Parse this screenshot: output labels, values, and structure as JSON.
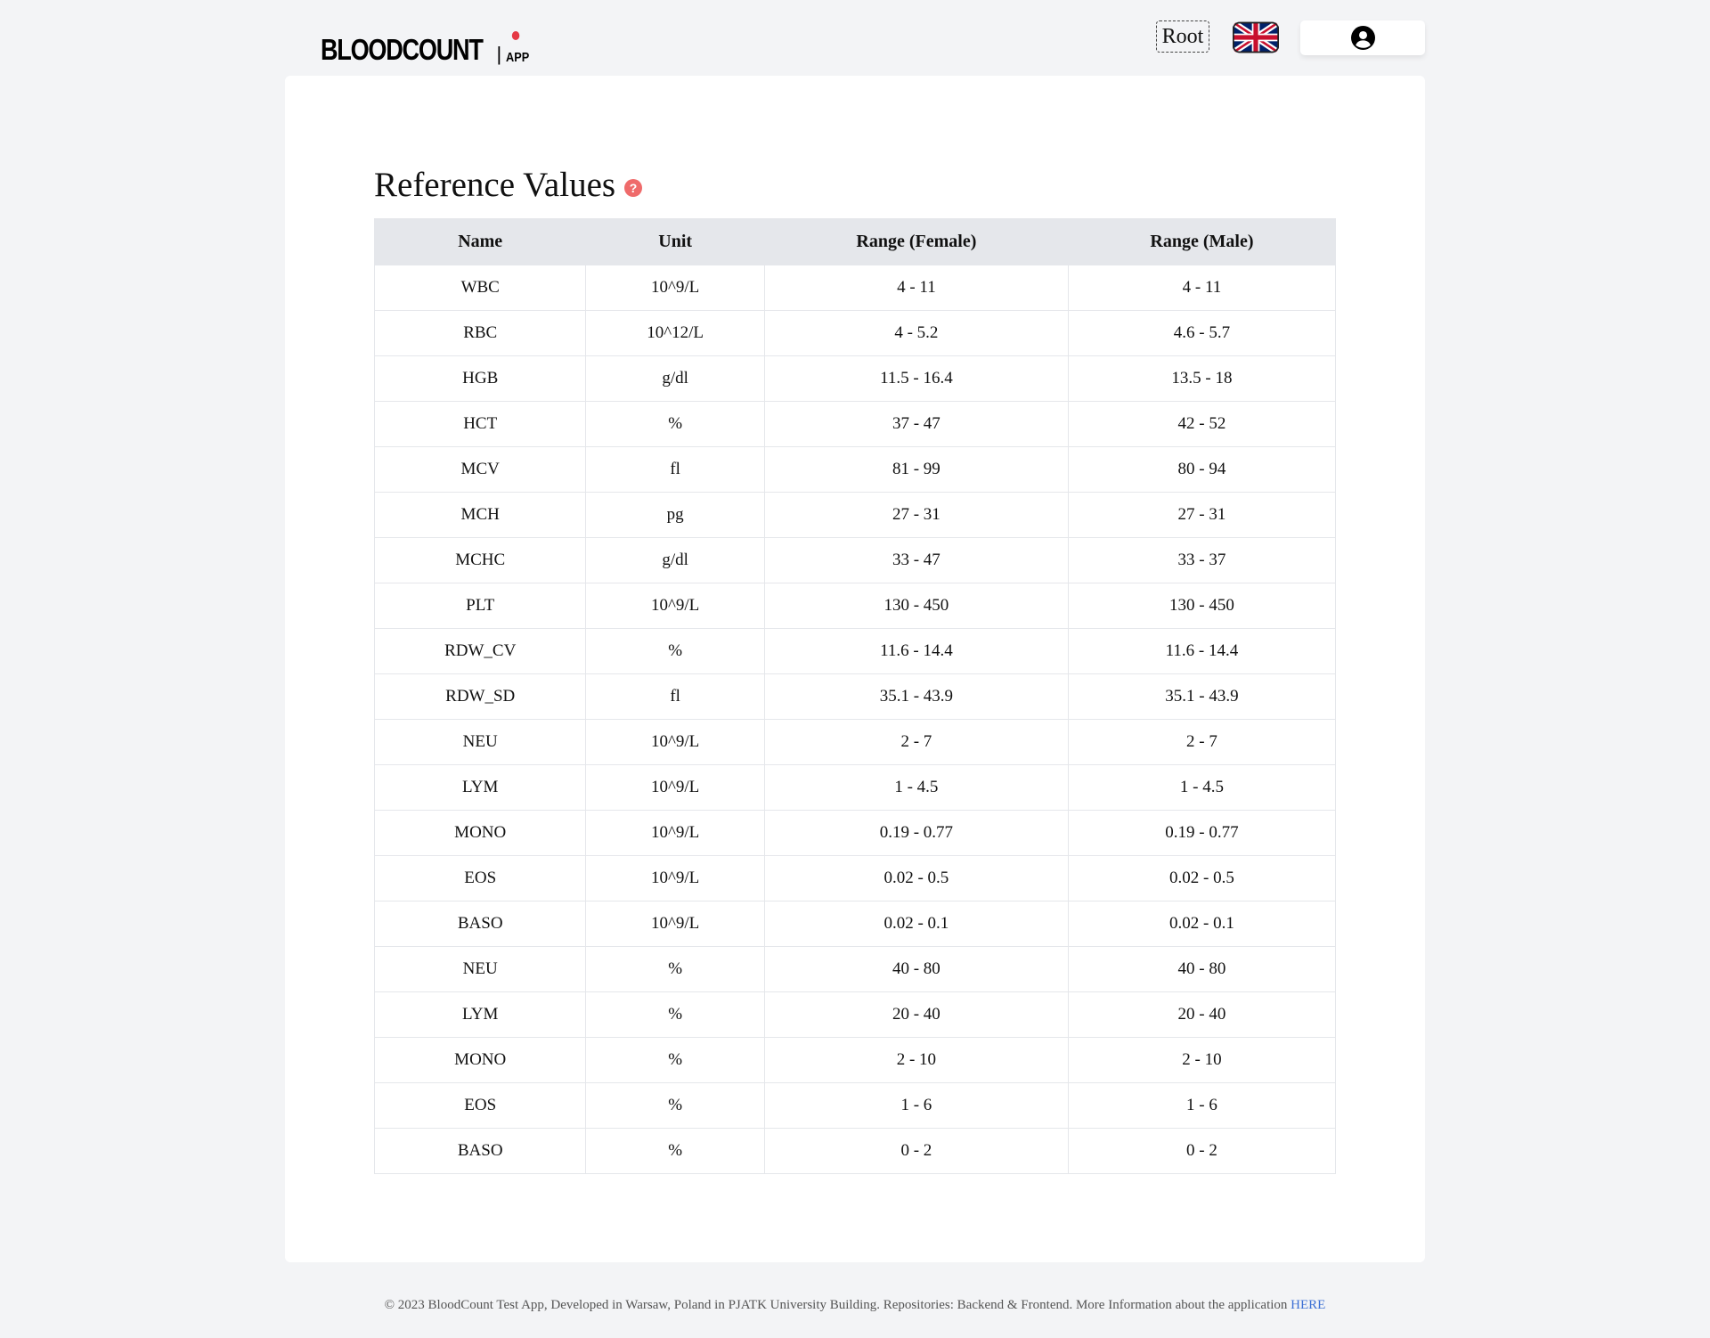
{
  "header": {
    "logo_main": "BLOODCOUNT",
    "logo_separator": "|",
    "logo_sub": "APP",
    "role_label": "Root",
    "language_icon": "uk-flag-icon",
    "account_icon": "user-circle-icon"
  },
  "main": {
    "title": "Reference Values",
    "help_icon": "question-circle-icon",
    "table": {
      "headers": [
        "Name",
        "Unit",
        "Range (Female)",
        "Range (Male)"
      ],
      "rows": [
        [
          "WBC",
          "10^9/L",
          "4 - 11",
          "4 - 11"
        ],
        [
          "RBC",
          "10^12/L",
          "4 - 5.2",
          "4.6 - 5.7"
        ],
        [
          "HGB",
          "g/dl",
          "11.5 - 16.4",
          "13.5 - 18"
        ],
        [
          "HCT",
          "%",
          "37 - 47",
          "42 - 52"
        ],
        [
          "MCV",
          "fl",
          "81 - 99",
          "80 - 94"
        ],
        [
          "MCH",
          "pg",
          "27 - 31",
          "27 - 31"
        ],
        [
          "MCHC",
          "g/dl",
          "33 - 47",
          "33 - 37"
        ],
        [
          "PLT",
          "10^9/L",
          "130 - 450",
          "130 - 450"
        ],
        [
          "RDW_CV",
          "%",
          "11.6 - 14.4",
          "11.6 - 14.4"
        ],
        [
          "RDW_SD",
          "fl",
          "35.1 - 43.9",
          "35.1 - 43.9"
        ],
        [
          "NEU",
          "10^9/L",
          "2 - 7",
          "2 - 7"
        ],
        [
          "LYM",
          "10^9/L",
          "1 - 4.5",
          "1 - 4.5"
        ],
        [
          "MONO",
          "10^9/L",
          "0.19 - 0.77",
          "0.19 - 0.77"
        ],
        [
          "EOS",
          "10^9/L",
          "0.02 - 0.5",
          "0.02 - 0.5"
        ],
        [
          "BASO",
          "10^9/L",
          "0.02 - 0.1",
          "0.02 - 0.1"
        ],
        [
          "NEU",
          "%",
          "40 - 80",
          "40 - 80"
        ],
        [
          "LYM",
          "%",
          "20 - 40",
          "20 - 40"
        ],
        [
          "MONO",
          "%",
          "2 - 10",
          "2 - 10"
        ],
        [
          "EOS",
          "%",
          "1 - 6",
          "1 - 6"
        ],
        [
          "BASO",
          "%",
          "0 - 2",
          "0 - 2"
        ]
      ]
    }
  },
  "footer": {
    "text": "© 2023 BloodCount Test App, Developed in Warsaw, Poland in PJATK University Building. Repositories: Backend & Frontend. More Information about the application",
    "link_label": "HERE",
    "link_color": "#3b6fd4"
  },
  "colors": {
    "page_background": "#f3f4f6",
    "card_background": "#ffffff",
    "table_header_background": "#e5e7eb",
    "logo_dot": "#e53945",
    "help_icon": "#ef6b6b"
  }
}
